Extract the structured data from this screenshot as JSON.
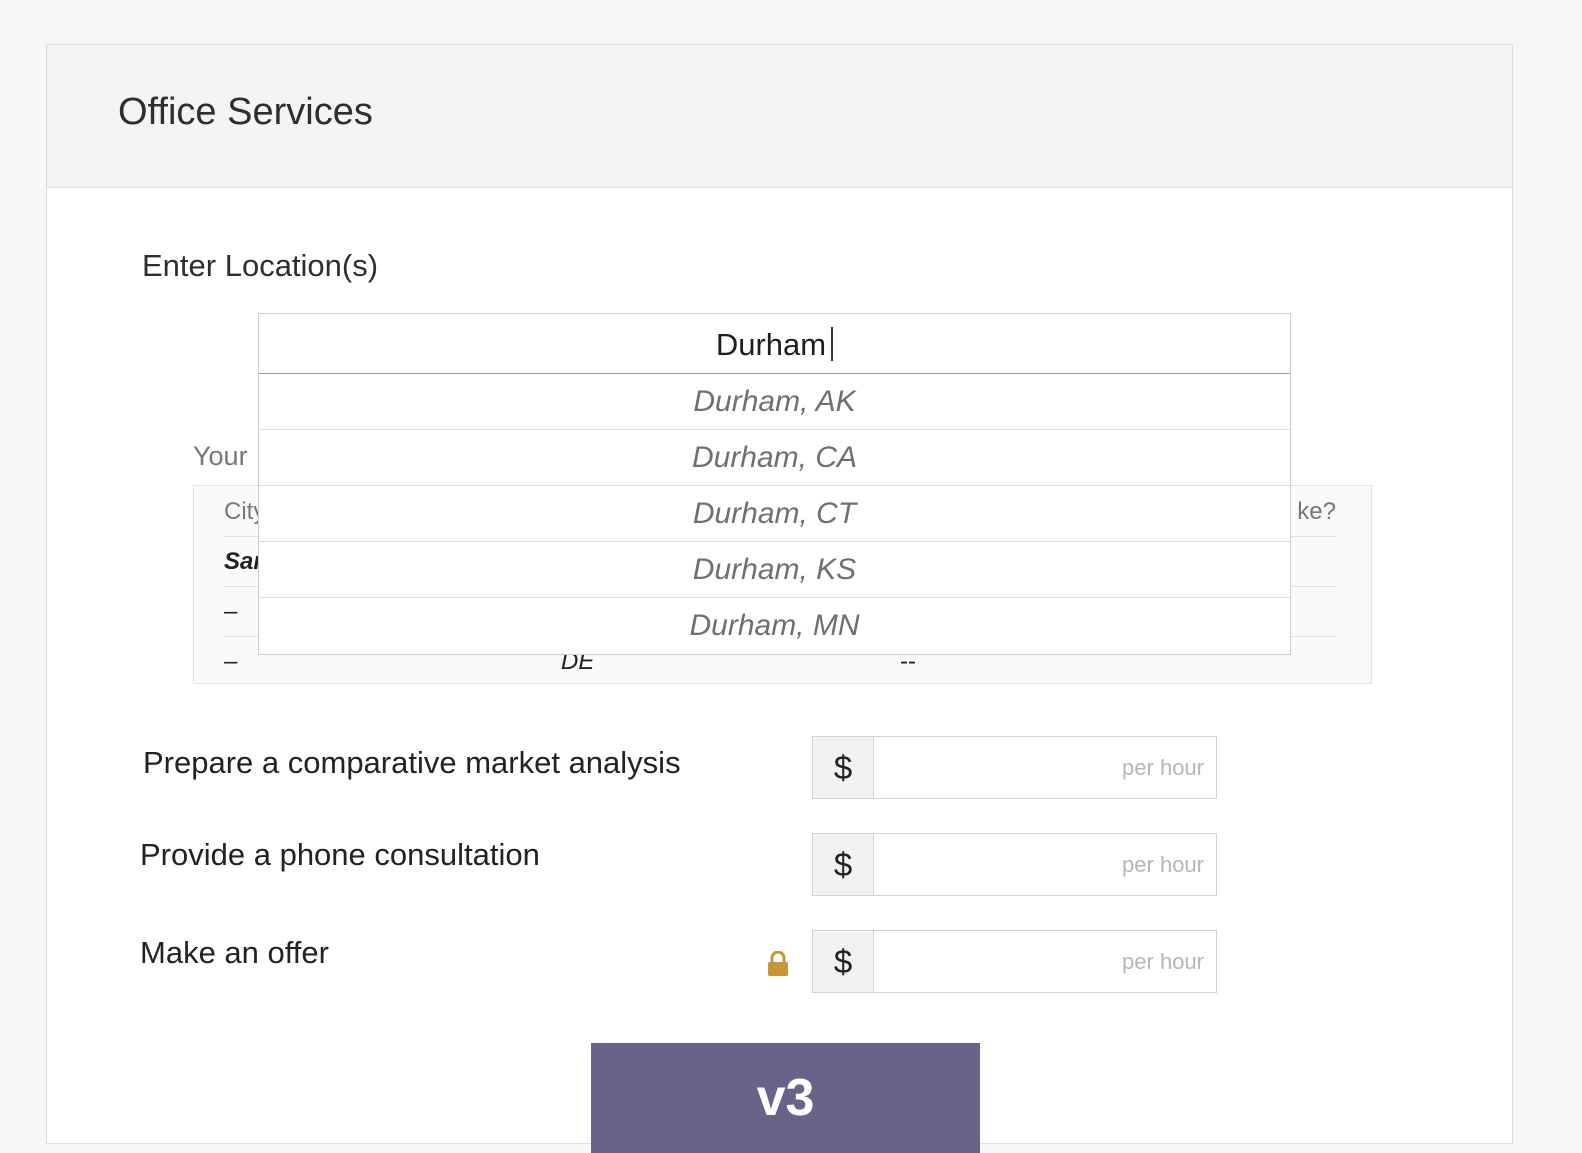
{
  "card": {
    "title": "Office Services"
  },
  "location": {
    "label": "Enter Location(s)",
    "input_value": "Durham",
    "suggestions": [
      "Durham, AK",
      "Durham, CA",
      "Durham, CT",
      "Durham, KS",
      "Durham, MN"
    ]
  },
  "table": {
    "label_visible": "Your",
    "header": {
      "col1": "City",
      "col4": "ke?"
    },
    "rows": [
      {
        "c1": "Sar",
        "c2": "",
        "c3": "",
        "c4": ""
      },
      {
        "c1": "–",
        "c2": "",
        "c3": "",
        "c4": ""
      },
      {
        "c1": "–",
        "c2": "DE",
        "c3": "--",
        "c4": ""
      }
    ]
  },
  "services": [
    {
      "label": "Prepare a comparative market analysis",
      "currency": "$",
      "placeholder": "per hour",
      "locked": false
    },
    {
      "label": "Provide a phone consultation",
      "currency": "$",
      "placeholder": "per hour",
      "locked": false
    },
    {
      "label": "Make an offer",
      "currency": "$",
      "placeholder": "per hour",
      "locked": true
    }
  ],
  "icons": {
    "lock": "lock-icon",
    "lock_color": "#c8953a"
  },
  "button": {
    "label": "v3",
    "color": "#6a6287"
  }
}
